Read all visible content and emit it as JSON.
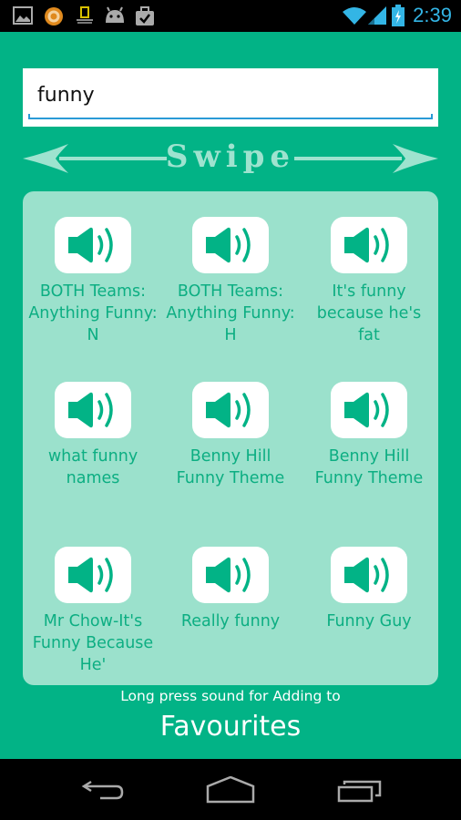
{
  "status_bar": {
    "time": "2:39",
    "notification_icons": [
      "gallery-icon",
      "orange-app-icon",
      "national-geographic-icon",
      "android-icon",
      "briefcase-check-icon"
    ],
    "system_icons": [
      "wifi-icon",
      "signal-icon",
      "battery-charging-icon"
    ],
    "accent_color": "#33b5e5"
  },
  "search": {
    "value": "funny",
    "placeholder": ""
  },
  "swipe": {
    "label": "Swipe"
  },
  "sounds": [
    {
      "label": "BOTH Teams: Anything Funny:  N",
      "icon": "speaker-icon"
    },
    {
      "label": "BOTH Teams: Anything Funny:  H",
      "icon": "speaker-icon"
    },
    {
      "label": "It's funny because he's fat",
      "icon": "speaker-icon"
    },
    {
      "label": "what funny names",
      "icon": "speaker-icon"
    },
    {
      "label": "Benny Hill Funny Theme",
      "icon": "speaker-icon"
    },
    {
      "label": "Benny Hill Funny Theme",
      "icon": "speaker-icon"
    },
    {
      "label": "Mr Chow-It's Funny Because He'",
      "icon": "speaker-icon"
    },
    {
      "label": "Really funny",
      "icon": "speaker-icon"
    },
    {
      "label": "Funny Guy",
      "icon": "speaker-icon"
    }
  ],
  "footer": {
    "hint": "Long press sound for Adding to",
    "favourites_label": "Favourites"
  },
  "navigation": {
    "buttons": [
      "back",
      "home",
      "recent-apps"
    ]
  },
  "colors": {
    "background": "#02b386",
    "panel": "#9be1cc",
    "label": "#0cae82",
    "input_underline": "#2a9ad6"
  }
}
